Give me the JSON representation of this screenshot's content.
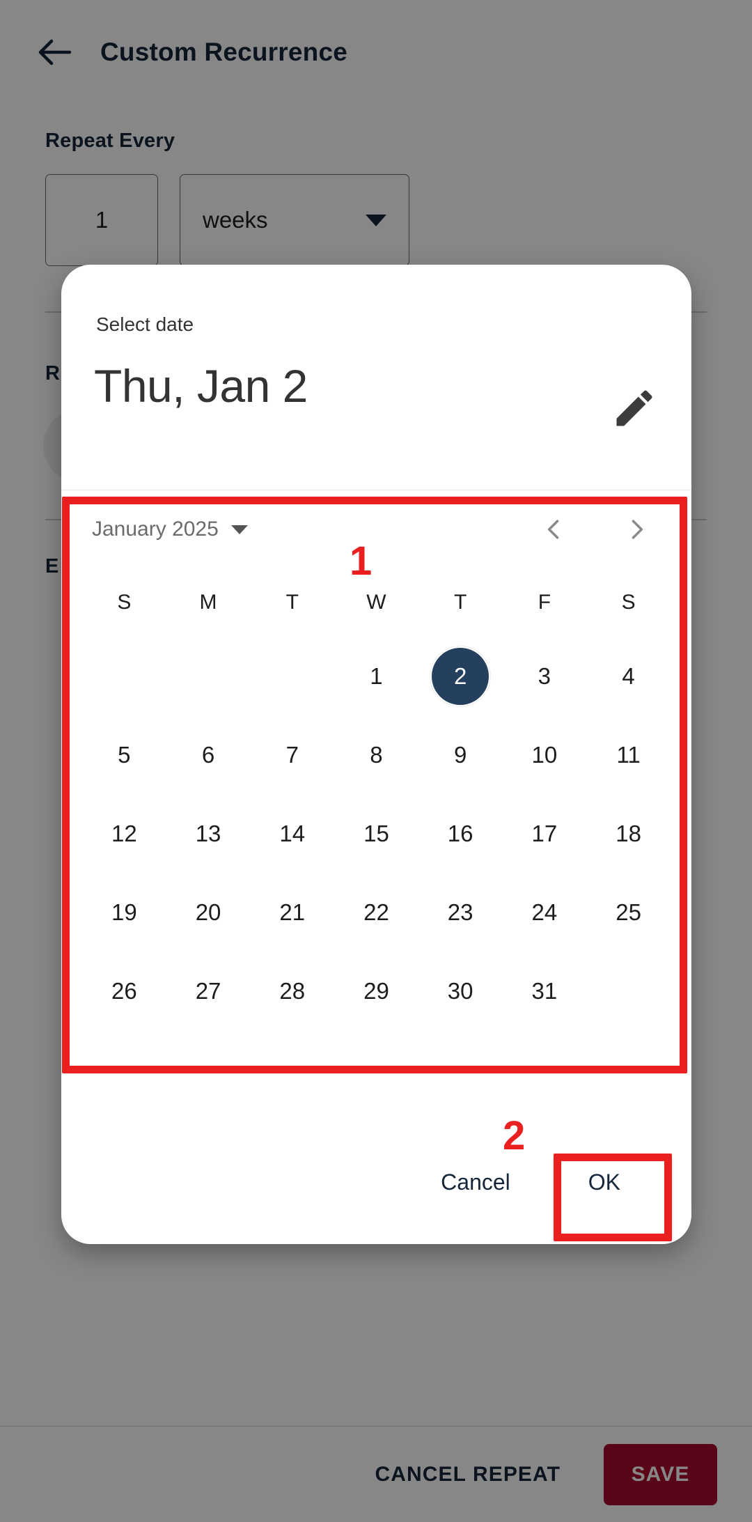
{
  "app": {
    "back_icon": "back-arrow-icon",
    "title": "Custom Recurrence"
  },
  "background_form": {
    "repeat_every_label": "Repeat Every",
    "interval_value": "1",
    "unit_value": "weeks",
    "unit_caret_icon": "chevron-down-icon",
    "repeat_on_label_partial": "R",
    "ends_label_partial": "E"
  },
  "bottom_bar": {
    "cancel_repeat_label": "CANCEL REPEAT",
    "save_label": "SAVE",
    "save_bg_color": "#a80b2c"
  },
  "dialog": {
    "supporting_text": "Select date",
    "selected_date_text": "Thu, Jan 2",
    "edit_icon": "pencil-icon",
    "month_label": "January 2025",
    "month_caret_icon": "chevron-down-icon",
    "prev_icon": "chevron-left-icon",
    "next_icon": "chevron-right-icon",
    "weekdays": [
      "S",
      "M",
      "T",
      "W",
      "T",
      "F",
      "S"
    ],
    "weeks": [
      [
        "",
        "",
        "",
        "1",
        "2",
        "3",
        "4"
      ],
      [
        "5",
        "6",
        "7",
        "8",
        "9",
        "10",
        "11"
      ],
      [
        "12",
        "13",
        "14",
        "15",
        "16",
        "17",
        "18"
      ],
      [
        "19",
        "20",
        "21",
        "22",
        "23",
        "24",
        "25"
      ],
      [
        "26",
        "27",
        "28",
        "29",
        "30",
        "31",
        ""
      ]
    ],
    "selected_day": "2",
    "selected_day_bg": "#25405f",
    "cancel_label": "Cancel",
    "ok_label": "OK"
  },
  "annotations": {
    "color": "#ea2020",
    "step_1": "1",
    "step_2": "2"
  }
}
